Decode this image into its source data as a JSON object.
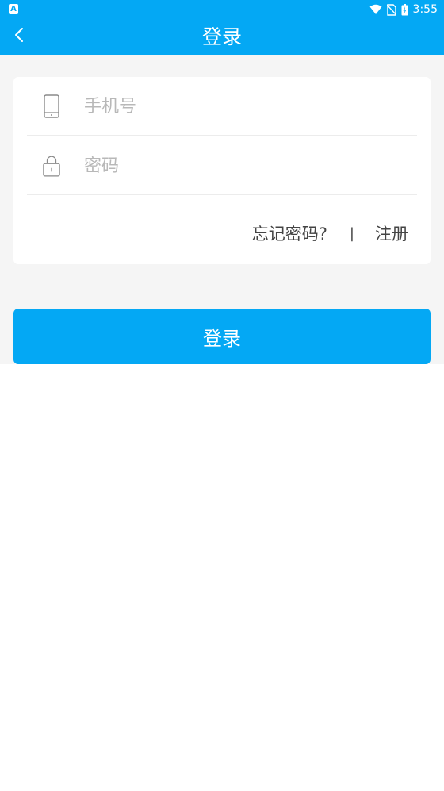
{
  "status_bar": {
    "left_icon": "A",
    "icons": [
      "wifi-icon",
      "no-sim-icon",
      "battery-charging-icon"
    ],
    "time": "3:55"
  },
  "header": {
    "back_icon": "chevron-left-icon",
    "title": "登录"
  },
  "form": {
    "phone": {
      "icon": "phone-icon",
      "placeholder": "手机号",
      "value": ""
    },
    "password": {
      "icon": "lock-icon",
      "placeholder": "密码",
      "value": ""
    },
    "links": {
      "forgot_password": "忘记密码?",
      "divider": "|",
      "register": "注册"
    }
  },
  "login_button": {
    "label": "登录"
  },
  "colors": {
    "primary": "#04a8f4",
    "background": "#f5f5f5",
    "card": "#ffffff",
    "placeholder": "#b8b8b8",
    "link_text": "#444444"
  }
}
